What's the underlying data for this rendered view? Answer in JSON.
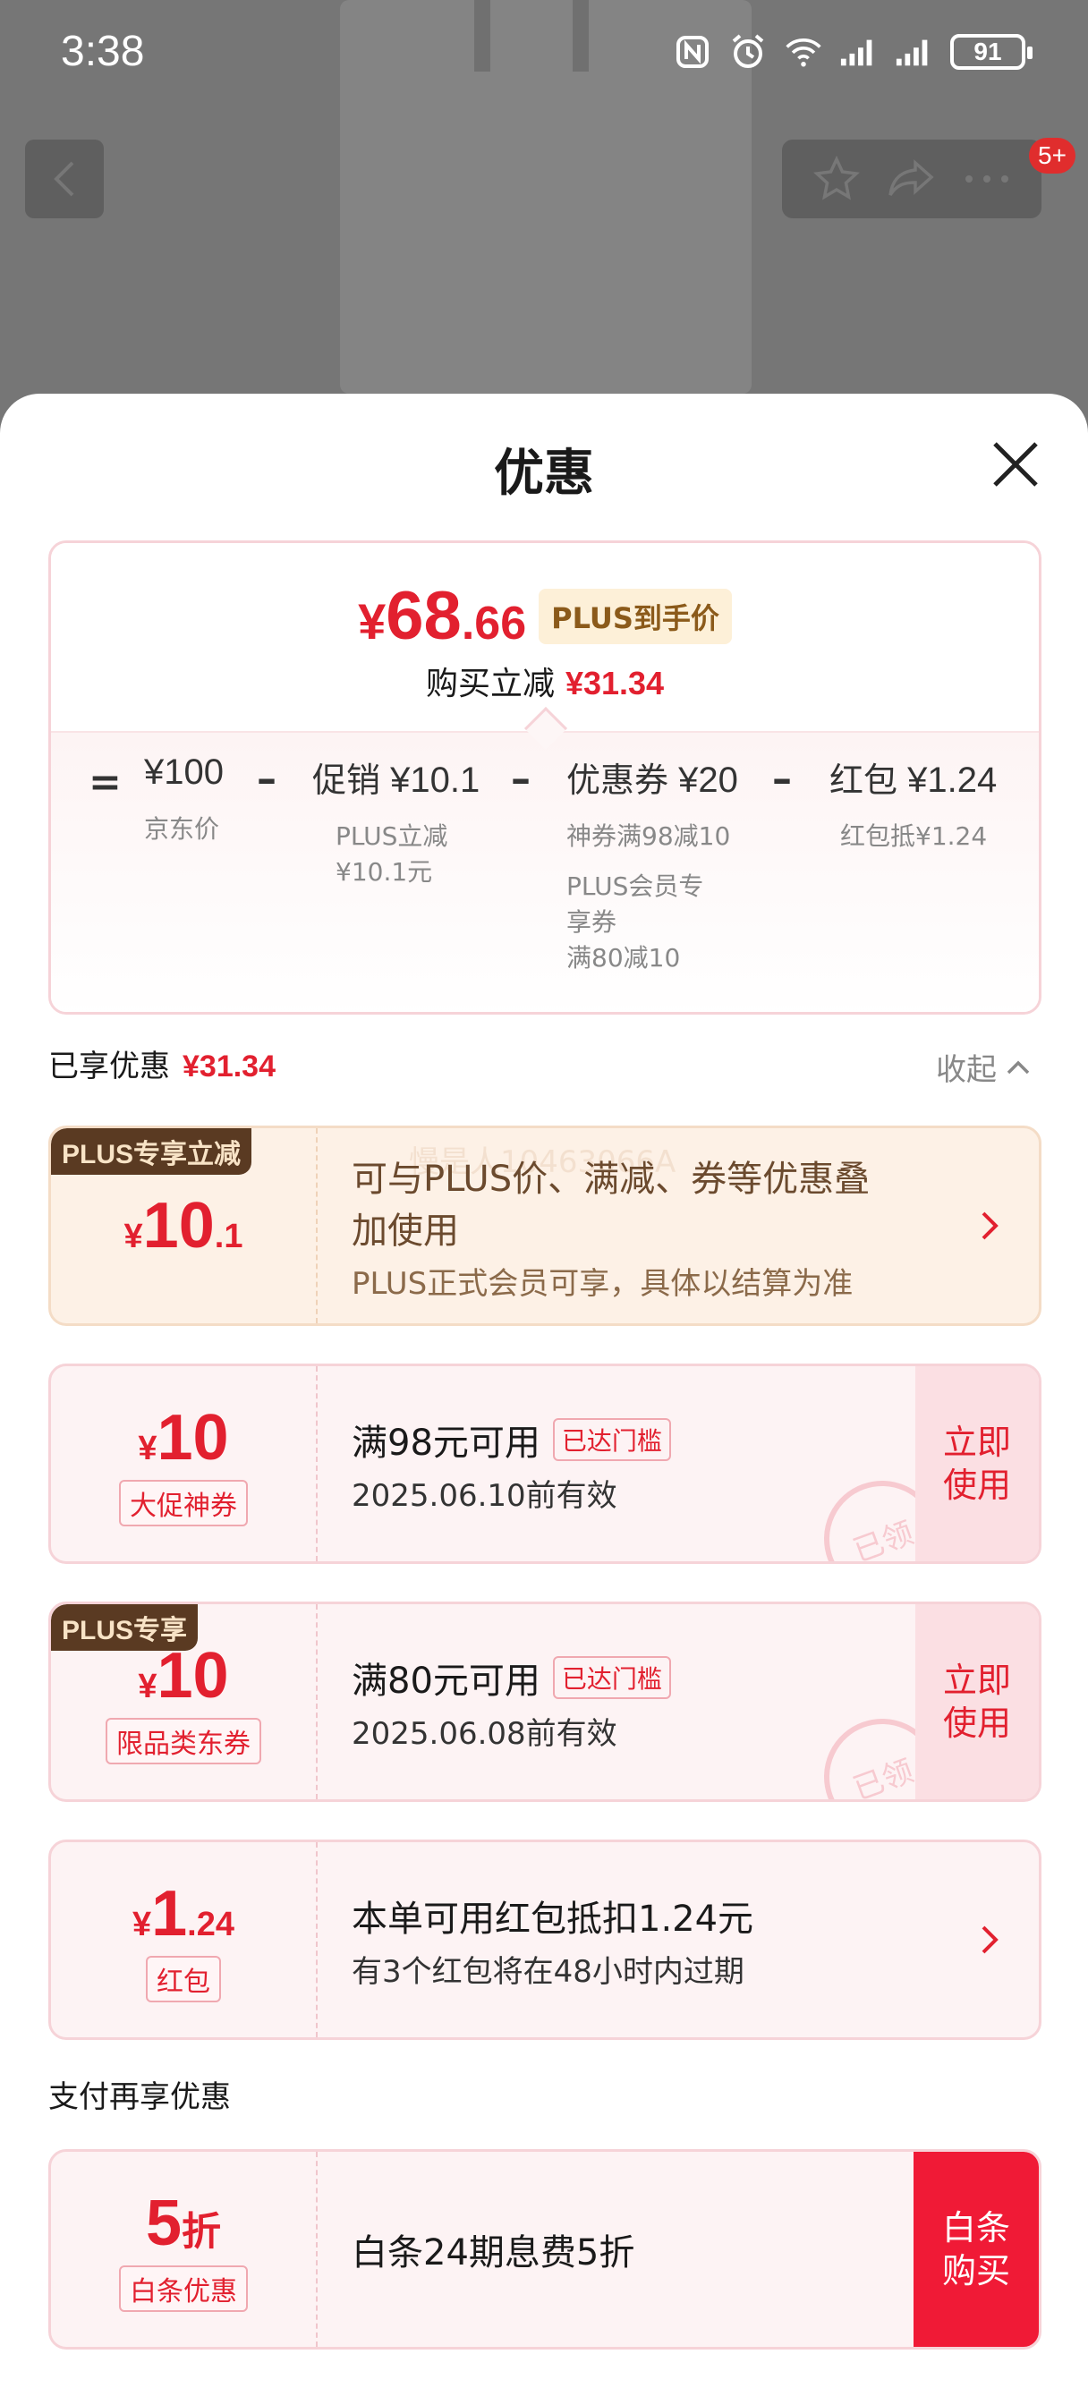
{
  "status_bar": {
    "time": "3:38",
    "battery": "91"
  },
  "nav": {
    "badge": "5+"
  },
  "sheet": {
    "title": "优惠"
  },
  "summary": {
    "price_yen": "¥",
    "price_int": "68",
    "price_dec": ".66",
    "plus_tag": "PLUS到手价",
    "save_label": "购买立减",
    "save_value": "¥31.34",
    "eq": "=",
    "minus": "–",
    "terms": [
      {
        "label": "",
        "value": "¥100",
        "notes": [
          "京东价"
        ]
      },
      {
        "label": "促销",
        "value": "¥10.1",
        "notes": [
          "PLUS立减",
          "¥10.1元"
        ]
      },
      {
        "label": "优惠券",
        "value": "¥20",
        "notes": [
          "神券满98减10",
          "PLUS会员专",
          "享券",
          "满80减10"
        ]
      },
      {
        "label": "红包",
        "value": "¥1.24",
        "notes": [
          "红包抵¥1.24"
        ]
      }
    ]
  },
  "enjoyed": {
    "label": "已享优惠",
    "value": "¥31.34",
    "collapse": "收起"
  },
  "cards": [
    {
      "corner": "PLUS专享立减",
      "yen": "¥",
      "int": "10",
      "dec": ".1",
      "watermark": "慢是人10463066A",
      "main": "可与PLUS价、满减、券等优惠叠",
      "main2": "加使用",
      "sub": "PLUS正式会员可享，具体以结算为准"
    },
    {
      "yen": "¥",
      "int": "10",
      "tag": "大促神券",
      "main": "满98元可用",
      "reached": "已达门槛",
      "sub": "2025.06.10前有效",
      "btn": "立即使用",
      "stamp": "已领"
    },
    {
      "corner": "PLUS专享",
      "yen": "¥",
      "int": "10",
      "tag": "限品类东券",
      "main": "满80元可用",
      "reached": "已达门槛",
      "sub": "2025.06.08前有效",
      "btn": "立即使用",
      "stamp": "已领"
    },
    {
      "yen": "¥",
      "int": "1",
      "dec": ".24",
      "tag": "红包",
      "main": "本单可用红包抵扣1.24元",
      "sub": "有3个红包将在48小时内过期"
    }
  ],
  "pay": {
    "label": "支付再享优惠",
    "int": "5",
    "unit": "折",
    "tag": "白条优惠",
    "main": "白条24期息费5折",
    "btn": "白条购买"
  }
}
